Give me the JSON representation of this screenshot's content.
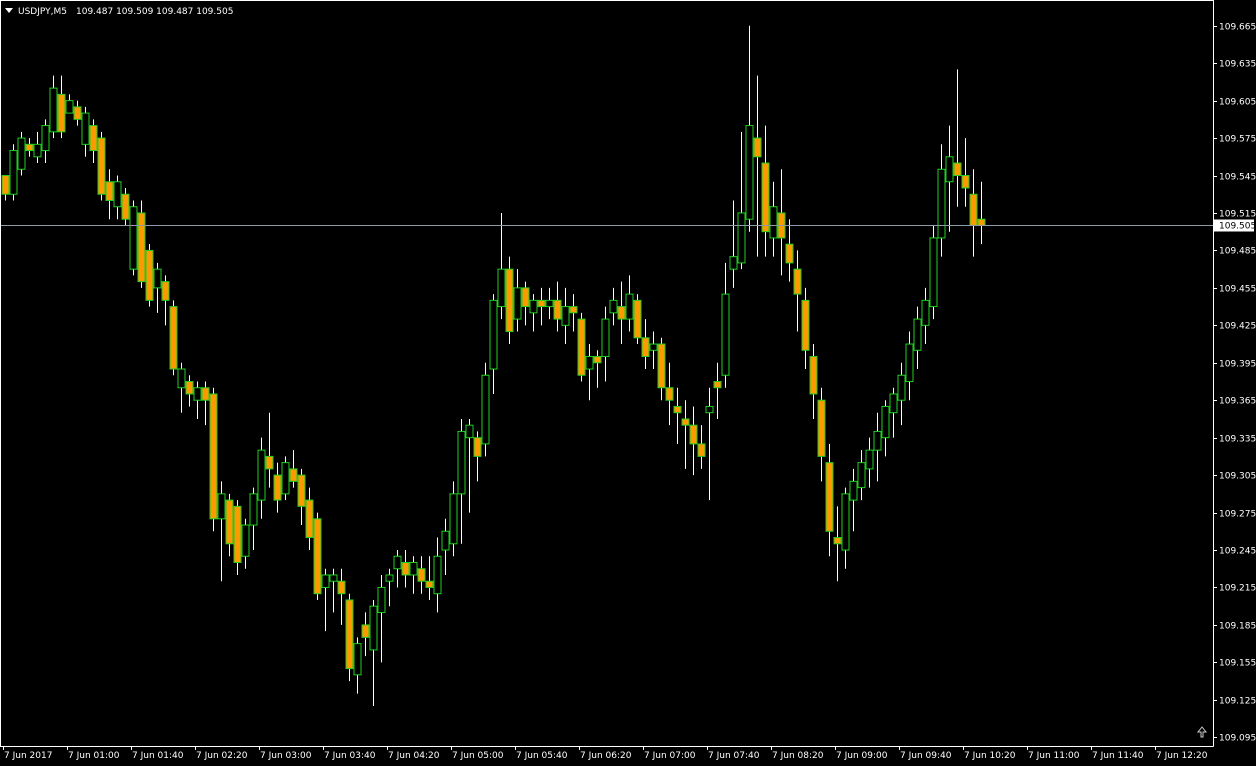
{
  "header": {
    "symbol_label": "USDJPY,M5",
    "ohlc_values": "109.487 109.509 109.487 109.505"
  },
  "colors": {
    "background": "#000000",
    "bull_outline": "#22cc22",
    "bear_fill": "#ff9900",
    "wick": "#ffffff",
    "axis": "#ffffff",
    "bid_line": "#8c9aa6",
    "price_label_bg": "#ffffff"
  },
  "icons": {
    "dropdown": "triangle-down-icon",
    "shift": "shift-marker-icon"
  },
  "chart_data": {
    "type": "candlestick",
    "timeframe": "M5",
    "y_ticks": [
      "109.665",
      "109.635",
      "109.605",
      "109.575",
      "109.545",
      "109.515",
      "109.485",
      "109.455",
      "109.425",
      "109.395",
      "109.365",
      "109.335",
      "109.305",
      "109.275",
      "109.245",
      "109.215",
      "109.185",
      "109.155",
      "109.125",
      "109.095"
    ],
    "x_ticks": [
      "7 Jun 2017",
      "7 Jun 01:00",
      "7 Jun 01:40",
      "7 Jun 02:20",
      "7 Jun 03:00",
      "7 Jun 03:40",
      "7 Jun 04:20",
      "7 Jun 05:00",
      "7 Jun 05:40",
      "7 Jun 06:20",
      "7 Jun 07:00",
      "7 Jun 07:40",
      "7 Jun 08:20",
      "7 Jun 09:00",
      "7 Jun 09:40",
      "7 Jun 10:20",
      "7 Jun 11:00",
      "7 Jun 11:40",
      "7 Jun 12:20"
    ],
    "ylim": [
      109.088,
      109.684
    ],
    "current_price": "109.505",
    "candles": [
      [
        109.545,
        109.545,
        109.525,
        109.53
      ],
      [
        109.53,
        109.57,
        109.525,
        109.565
      ],
      [
        109.55,
        109.58,
        109.545,
        109.575
      ],
      [
        109.57,
        109.575,
        109.56,
        109.565
      ],
      [
        109.56,
        109.58,
        109.555,
        109.57
      ],
      [
        109.565,
        109.59,
        109.555,
        109.585
      ],
      [
        109.58,
        109.625,
        109.575,
        109.615
      ],
      [
        109.61,
        109.625,
        109.575,
        109.58
      ],
      [
        109.595,
        109.61,
        109.595,
        109.605
      ],
      [
        109.6,
        109.605,
        109.585,
        109.59
      ],
      [
        109.57,
        109.6,
        109.56,
        109.595
      ],
      [
        109.585,
        109.59,
        109.555,
        109.565
      ],
      [
        109.575,
        109.58,
        109.525,
        109.53
      ],
      [
        109.54,
        109.55,
        109.51,
        109.525
      ],
      [
        109.52,
        109.545,
        109.51,
        109.54
      ],
      [
        109.53,
        109.535,
        109.505,
        109.51
      ],
      [
        109.47,
        109.525,
        109.465,
        109.52
      ],
      [
        109.515,
        109.525,
        109.455,
        109.46
      ],
      [
        109.485,
        109.49,
        109.44,
        109.445
      ],
      [
        109.455,
        109.475,
        109.435,
        109.47
      ],
      [
        109.46,
        109.465,
        109.425,
        109.445
      ],
      [
        109.44,
        109.445,
        109.385,
        109.39
      ],
      [
        109.375,
        109.395,
        109.355,
        109.39
      ],
      [
        109.38,
        109.385,
        109.36,
        109.37
      ],
      [
        109.365,
        109.38,
        109.35,
        109.375
      ],
      [
        109.375,
        109.38,
        109.345,
        109.365
      ],
      [
        109.37,
        109.375,
        109.26,
        109.27
      ],
      [
        109.27,
        109.3,
        109.22,
        109.29
      ],
      [
        109.285,
        109.29,
        109.24,
        109.25
      ],
      [
        109.28,
        109.285,
        109.225,
        109.235
      ],
      [
        109.24,
        109.27,
        109.23,
        109.265
      ],
      [
        109.265,
        109.295,
        109.245,
        109.29
      ],
      [
        109.285,
        109.335,
        109.27,
        109.325
      ],
      [
        109.32,
        109.355,
        109.295,
        109.31
      ],
      [
        109.305,
        109.315,
        109.275,
        109.285
      ],
      [
        109.29,
        109.32,
        109.285,
        109.315
      ],
      [
        109.31,
        109.325,
        109.295,
        109.3
      ],
      [
        109.305,
        109.31,
        109.265,
        109.28
      ],
      [
        109.285,
        109.295,
        109.245,
        109.255
      ],
      [
        109.27,
        109.275,
        109.205,
        109.21
      ],
      [
        109.215,
        109.23,
        109.18,
        109.225
      ],
      [
        109.22,
        109.23,
        109.195,
        109.225
      ],
      [
        109.22,
        109.23,
        109.185,
        109.21
      ],
      [
        109.205,
        109.21,
        109.14,
        109.15
      ],
      [
        109.145,
        109.175,
        109.13,
        109.17
      ],
      [
        109.185,
        109.195,
        109.16,
        109.175
      ],
      [
        109.165,
        109.205,
        109.12,
        109.2
      ],
      [
        109.195,
        109.225,
        109.155,
        109.215
      ],
      [
        109.22,
        109.23,
        109.2,
        109.225
      ],
      [
        109.23,
        109.245,
        109.215,
        109.24
      ],
      [
        109.235,
        109.245,
        109.215,
        109.225
      ],
      [
        109.225,
        109.24,
        109.21,
        109.235
      ],
      [
        109.23,
        109.24,
        109.21,
        109.22
      ],
      [
        109.22,
        109.24,
        109.205,
        109.215
      ],
      [
        109.21,
        109.255,
        109.195,
        109.24
      ],
      [
        109.245,
        109.27,
        109.225,
        109.26
      ],
      [
        109.25,
        109.3,
        109.24,
        109.29
      ],
      [
        109.29,
        109.35,
        109.25,
        109.34
      ],
      [
        109.335,
        109.35,
        109.275,
        109.345
      ],
      [
        109.335,
        109.34,
        109.3,
        109.32
      ],
      [
        109.33,
        109.395,
        109.32,
        109.385
      ],
      [
        109.39,
        109.45,
        109.37,
        109.445
      ],
      [
        109.44,
        109.515,
        109.43,
        109.47
      ],
      [
        109.47,
        109.48,
        109.41,
        109.42
      ],
      [
        109.43,
        109.47,
        109.42,
        109.455
      ],
      [
        109.455,
        109.46,
        109.425,
        109.44
      ],
      [
        109.435,
        109.45,
        109.42,
        109.445
      ],
      [
        109.445,
        109.455,
        109.425,
        109.44
      ],
      [
        109.44,
        109.455,
        109.43,
        109.445
      ],
      [
        109.445,
        109.46,
        109.42,
        109.43
      ],
      [
        109.425,
        109.455,
        109.41,
        109.44
      ],
      [
        109.44,
        109.45,
        109.42,
        109.435
      ],
      [
        109.43,
        109.435,
        109.38,
        109.385
      ],
      [
        109.39,
        109.41,
        109.365,
        109.4
      ],
      [
        109.4,
        109.405,
        109.375,
        109.395
      ],
      [
        109.4,
        109.44,
        109.38,
        109.43
      ],
      [
        109.435,
        109.455,
        109.425,
        109.445
      ],
      [
        109.44,
        109.46,
        109.41,
        109.43
      ],
      [
        109.43,
        109.465,
        109.42,
        109.45
      ],
      [
        109.445,
        109.45,
        109.41,
        109.415
      ],
      [
        109.415,
        109.43,
        109.39,
        109.4
      ],
      [
        109.405,
        109.42,
        109.39,
        109.41
      ],
      [
        109.41,
        109.415,
        109.365,
        109.375
      ],
      [
        109.375,
        109.395,
        109.345,
        109.365
      ],
      [
        109.36,
        109.375,
        109.33,
        109.355
      ],
      [
        109.35,
        109.365,
        109.31,
        109.345
      ],
      [
        109.345,
        109.36,
        109.305,
        109.33
      ],
      [
        109.33,
        109.345,
        109.31,
        109.32
      ],
      [
        109.355,
        109.375,
        109.285,
        109.36
      ],
      [
        109.38,
        109.395,
        109.35,
        109.375
      ],
      [
        109.385,
        109.475,
        109.375,
        109.45
      ],
      [
        109.47,
        109.525,
        109.455,
        109.48
      ],
      [
        109.475,
        109.58,
        109.47,
        109.515
      ],
      [
        109.51,
        109.665,
        109.5,
        109.585
      ],
      [
        109.575,
        109.625,
        109.48,
        109.56
      ],
      [
        109.555,
        109.585,
        109.48,
        109.5
      ],
      [
        109.495,
        109.54,
        109.48,
        109.52
      ],
      [
        109.515,
        109.55,
        109.465,
        109.495
      ],
      [
        109.49,
        109.51,
        109.46,
        109.475
      ],
      [
        109.47,
        109.485,
        109.42,
        109.45
      ],
      [
        109.445,
        109.455,
        109.39,
        109.405
      ],
      [
        109.4,
        109.41,
        109.35,
        109.37
      ],
      [
        109.365,
        109.375,
        109.3,
        109.32
      ],
      [
        109.315,
        109.33,
        109.24,
        109.26
      ],
      [
        109.255,
        109.28,
        109.22,
        109.25
      ],
      [
        109.245,
        109.295,
        109.23,
        109.29
      ],
      [
        109.285,
        109.31,
        109.26,
        109.3
      ],
      [
        109.295,
        109.325,
        109.285,
        109.315
      ],
      [
        109.31,
        109.335,
        109.295,
        109.325
      ],
      [
        109.325,
        109.355,
        109.3,
        109.34
      ],
      [
        109.335,
        109.365,
        109.32,
        109.36
      ],
      [
        109.355,
        109.375,
        109.335,
        109.37
      ],
      [
        109.365,
        109.395,
        109.345,
        109.385
      ],
      [
        109.38,
        109.42,
        109.365,
        109.41
      ],
      [
        109.405,
        109.44,
        109.39,
        109.43
      ],
      [
        109.425,
        109.455,
        109.41,
        109.445
      ],
      [
        109.44,
        109.505,
        109.43,
        109.495
      ],
      [
        109.495,
        109.57,
        109.48,
        109.55
      ],
      [
        109.54,
        109.585,
        109.5,
        109.56
      ],
      [
        109.555,
        109.63,
        109.52,
        109.545
      ],
      [
        109.545,
        109.575,
        109.52,
        109.535
      ],
      [
        109.53,
        109.55,
        109.48,
        109.505
      ],
      [
        109.51,
        109.54,
        109.49,
        109.505
      ]
    ]
  }
}
